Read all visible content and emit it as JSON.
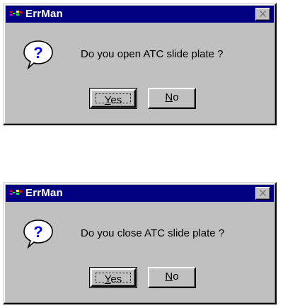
{
  "dialogs": [
    {
      "title": "ErrMan",
      "message": "Do you open ATC slide plate ?",
      "yes_mnemonic": "Y",
      "yes_rest": "es",
      "no_mnemonic": "N",
      "no_rest": "o"
    },
    {
      "title": "ErrMan",
      "message": "Do you close ATC slide plate ?",
      "yes_mnemonic": "Y",
      "yes_rest": "es",
      "no_mnemonic": "N",
      "no_rest": "o"
    }
  ],
  "icons": {
    "app": "errman-app-icon",
    "close": "close-icon",
    "message": "question-icon"
  },
  "colors": {
    "titlebar": "#000080",
    "face": "#c0c0c0",
    "question_blue": "#0000ff"
  }
}
